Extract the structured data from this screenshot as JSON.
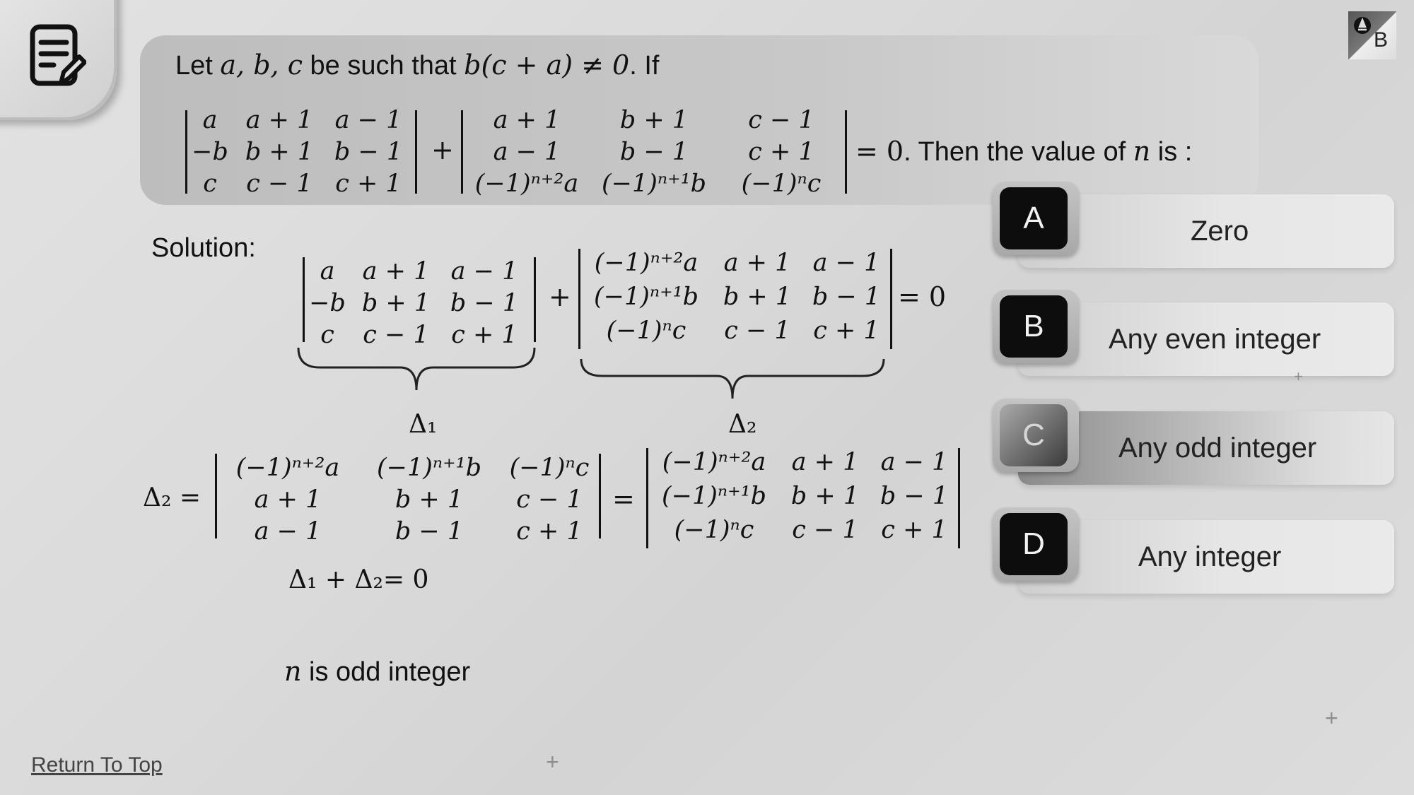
{
  "question": {
    "line1_prefix": "Let ",
    "line1_vars": "a, b, c",
    "line1_mid": "  be such that ",
    "line1_cond": "b(c + a) ≠ 0",
    "line1_suffix": ". If",
    "det1": [
      [
        "a",
        "a + 1",
        "a − 1"
      ],
      [
        "−b",
        "b + 1",
        "b − 1"
      ],
      [
        "c",
        "c − 1",
        "c + 1"
      ]
    ],
    "det2": [
      [
        "a + 1",
        "b + 1",
        "c − 1"
      ],
      [
        "a − 1",
        "b − 1",
        "c + 1"
      ],
      [
        "(−1)ⁿ⁺²a",
        "(−1)ⁿ⁺¹b",
        "(−1)ⁿc"
      ]
    ],
    "plus": "+",
    "equals_zero": "= 0",
    "then_text": ". Then the value of ",
    "n": "n",
    "is_text": " is :"
  },
  "options": [
    {
      "letter": "A",
      "text": "Zero"
    },
    {
      "letter": "B",
      "text": "Any even integer"
    },
    {
      "letter": "C",
      "text": "Any odd integer"
    },
    {
      "letter": "D",
      "text": "Any integer"
    }
  ],
  "solution": {
    "label": "Solution:",
    "detA": [
      [
        "a",
        "a + 1",
        "a − 1"
      ],
      [
        "−b",
        "b + 1",
        "b − 1"
      ],
      [
        "c",
        "c − 1",
        "c + 1"
      ]
    ],
    "detB": [
      [
        "(−1)ⁿ⁺²a",
        "a + 1",
        "a − 1"
      ],
      [
        "(−1)ⁿ⁺¹b",
        "b + 1",
        "b − 1"
      ],
      [
        "(−1)ⁿc",
        "c − 1",
        "c + 1"
      ]
    ],
    "delta1": "Δ₁",
    "delta2": "Δ₂",
    "delta2_eq": "Δ₂  =",
    "detC": [
      [
        "(−1)ⁿ⁺²a",
        "(−1)ⁿ⁺¹b",
        "(−1)ⁿc"
      ],
      [
        "a + 1",
        "b + 1",
        "c − 1"
      ],
      [
        "a − 1",
        "b − 1",
        "c + 1"
      ]
    ],
    "detD": [
      [
        "(−1)ⁿ⁺²a",
        "a + 1",
        "a − 1"
      ],
      [
        "(−1)ⁿ⁺¹b",
        "b + 1",
        "b − 1"
      ],
      [
        "(−1)ⁿc",
        "c − 1",
        "c + 1"
      ]
    ],
    "sum_eq": "Δ₁ + Δ₂= 0",
    "conclusion_n": "n",
    "conclusion_text": " is odd integer"
  },
  "footer": {
    "return_top": "Return To Top"
  },
  "icons": {
    "notes": "notes-edit-icon",
    "logo": "brand-logo-icon"
  }
}
